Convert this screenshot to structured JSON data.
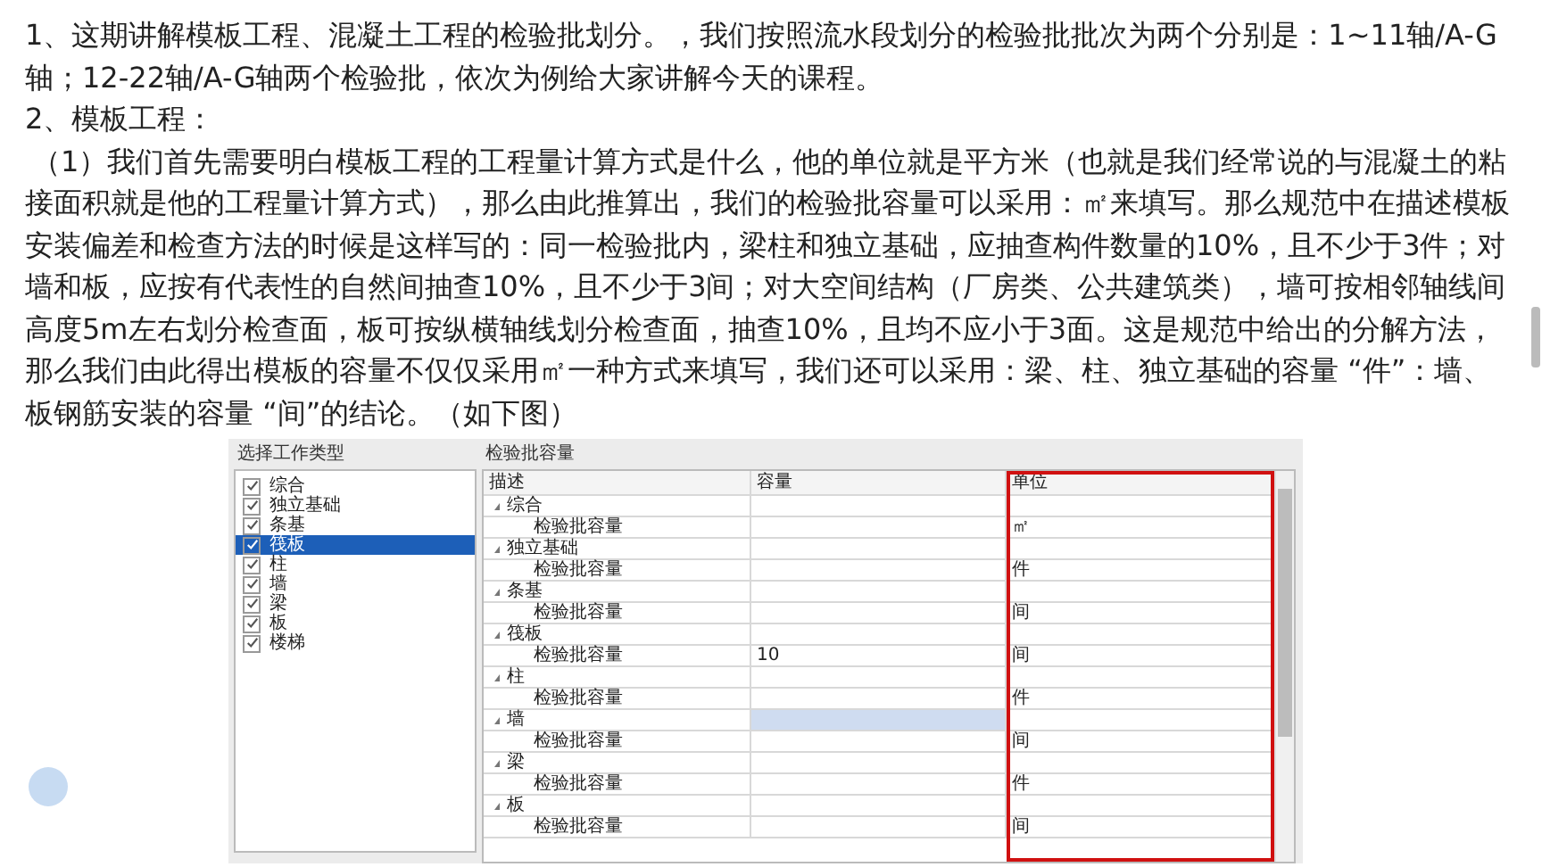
{
  "paragraphs": [
    "1、这期讲解模板工程、混凝土工程的检验批划分。，我们按照流水段划分的检验批批次为两个分别是：1~11轴/A-G轴；12-22轴/A-G轴两个检验批，依次为例给大家讲解今天的课程。",
    "2、模板工程：",
    "（1）我们首先需要明白模板工程的工程量计算方式是什么，他的单位就是平方米（也就是我们经常说的与混凝土的粘接面积就是他的工程量计算方式），那么由此推算出，我们的检验批容量可以采用：㎡来填写。那么规范中在描述模板安装偏差和检查方法的时候是这样写的：同一检验批内，梁柱和独立基础，应抽查构件数量的10%，且不少于3件；对墙和板，应按有代表性的自然间抽查10%，且不少于3间；对大空间结构（厂房类、公共建筑类），墙可按相邻轴线间高度5m左右划分检查面，板可按纵横轴线划分检查面，抽查10%，且均不应小于3面。这是规范中给出的分解方法，那么我们由此得出模板的容量不仅仅采用㎡一种方式来填写，我们还可以采用：梁、柱、独立基础的容量 “件”：墙、板钢筋安装的容量 “间”的结论。（如下图）"
  ],
  "work_type_panel": {
    "title": "选择工作类型",
    "items": [
      {
        "label": "综合",
        "checked": true,
        "selected": false
      },
      {
        "label": "独立基础",
        "checked": true,
        "selected": false
      },
      {
        "label": "条基",
        "checked": true,
        "selected": false
      },
      {
        "label": "筏板",
        "checked": true,
        "selected": true
      },
      {
        "label": "柱",
        "checked": true,
        "selected": false
      },
      {
        "label": "墙",
        "checked": true,
        "selected": false
      },
      {
        "label": "梁",
        "checked": true,
        "selected": false
      },
      {
        "label": "板",
        "checked": true,
        "selected": false
      },
      {
        "label": "楼梯",
        "checked": true,
        "selected": false
      }
    ]
  },
  "capacity_panel": {
    "title": "检验批容量",
    "columns": [
      {
        "label": "描述",
        "outlined": false
      },
      {
        "label": "容量",
        "outlined": false
      },
      {
        "label": "单位",
        "outlined": true
      }
    ],
    "groups": [
      {
        "name": "综合",
        "expanded": true,
        "selected": false,
        "rows": [
          {
            "name": "检验批容量",
            "unit": "㎡"
          }
        ]
      },
      {
        "name": "独立基础",
        "expanded": true,
        "selected": false,
        "rows": [
          {
            "name": "检验批容量",
            "unit": "件"
          }
        ]
      },
      {
        "name": "条基",
        "expanded": true,
        "selected": false,
        "rows": [
          {
            "name": "检验批容量",
            "unit": "间"
          }
        ]
      },
      {
        "name": "筏板",
        "expanded": true,
        "selected": false,
        "rows": [
          {
            "name": "检验批容量",
            "capacity": "10",
            "unit": "间"
          }
        ]
      },
      {
        "name": "柱",
        "expanded": true,
        "selected": false,
        "rows": [
          {
            "name": "检验批容量",
            "unit": "件"
          }
        ]
      },
      {
        "name": "墙",
        "expanded": true,
        "selected": true,
        "rows": [
          {
            "name": "检验批容量",
            "unit": "间"
          }
        ]
      },
      {
        "name": "梁",
        "expanded": true,
        "selected": false,
        "rows": [
          {
            "name": "检验批容量",
            "unit": "件"
          }
        ]
      },
      {
        "name": "板",
        "expanded": true,
        "selected": false,
        "rows": [
          {
            "name": "检验批容量",
            "unit": "间"
          }
        ]
      }
    ]
  }
}
